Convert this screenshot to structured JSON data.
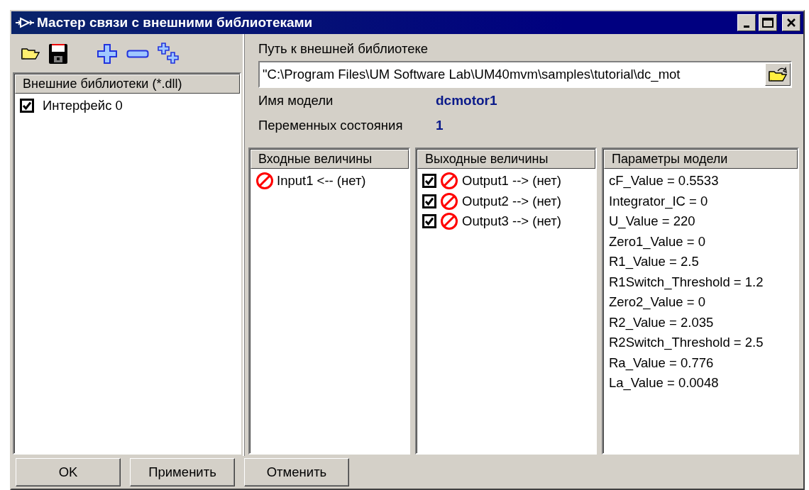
{
  "window": {
    "title": "Мастер связи с внешними библиотеками"
  },
  "toolbar": [
    {
      "kind": "open"
    },
    {
      "kind": "save"
    },
    {
      "kind": "add"
    },
    {
      "kind": "remove"
    },
    {
      "kind": "add_many"
    }
  ],
  "libraries": {
    "header": "Внешние библиотеки (*.dll)",
    "items": [
      {
        "label": "Интерфейс 0",
        "checked": true
      }
    ]
  },
  "path": {
    "label": "Путь к внешней библиотеке",
    "value": "\"C:\\Program Files\\UM Software Lab\\UM40mvm\\samples\\tutorial\\dc_mot"
  },
  "model_name": {
    "label": "Имя модели",
    "value": "dcmotor1"
  },
  "state_variables": {
    "label": "Переменных состояния",
    "value": "1"
  },
  "inputs": {
    "header": "Входные величины",
    "items": [
      {
        "label": "Input1 <-- (нет)",
        "connected": false
      }
    ]
  },
  "outputs": {
    "header": "Выходные величины",
    "items": [
      {
        "label": "Output1 --> (нет)",
        "checked": true,
        "connected": false
      },
      {
        "label": "Output2 --> (нет)",
        "checked": true,
        "connected": false
      },
      {
        "label": "Output3 --> (нет)",
        "checked": true,
        "connected": false
      }
    ]
  },
  "parameters": {
    "header": "Параметры модели",
    "items": [
      "cF_Value = 0.5533",
      "Integrator_IC = 0",
      "U_Value = 220",
      "Zero1_Value = 0",
      "R1_Value = 2.5",
      "R1Switch_Threshold = 1.2",
      "Zero2_Value = 0",
      "R2_Value = 2.035",
      "R2Switch_Threshold = 2.5",
      "Ra_Value = 0.776",
      "La_Value = 0.0048"
    ]
  },
  "buttons": [
    "OK",
    "Применить",
    "Отменить"
  ]
}
